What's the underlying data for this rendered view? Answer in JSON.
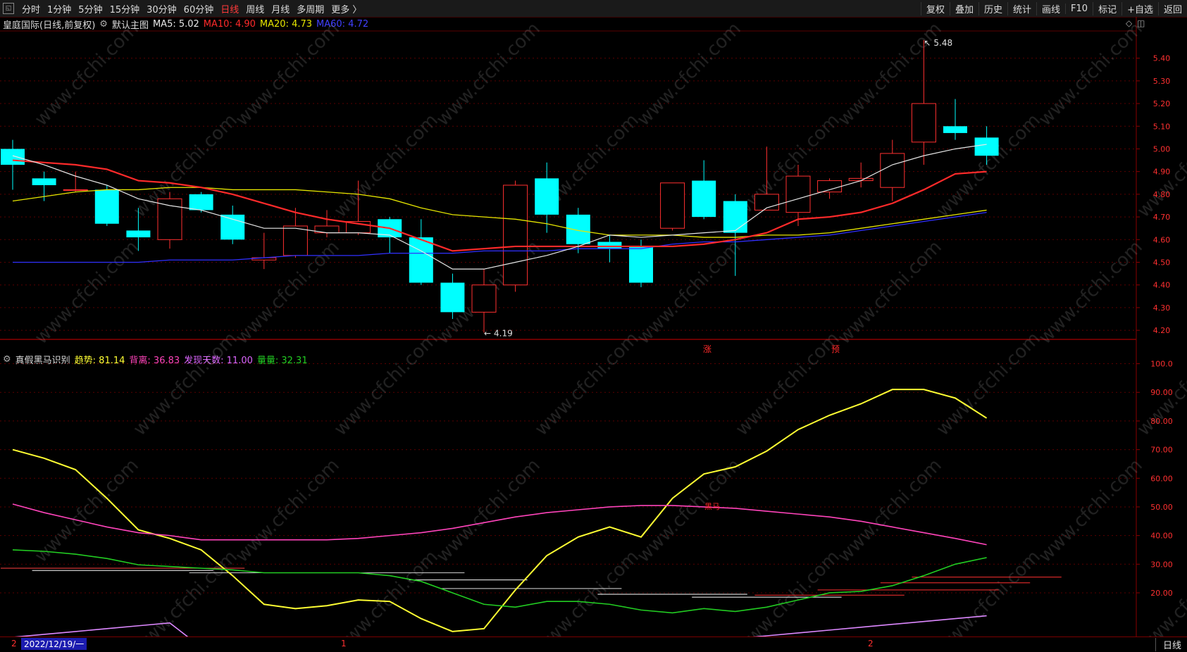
{
  "toolbar": {
    "periods": [
      "分时",
      "1分钟",
      "5分钟",
      "15分钟",
      "30分钟",
      "60分钟",
      "日线",
      "周线",
      "月线",
      "多周期",
      "更多 〉"
    ],
    "active": "日线",
    "right": [
      "复权",
      "叠加",
      "历史",
      "统计",
      "画线",
      "F10",
      "标记",
      "+自选",
      "返回"
    ]
  },
  "main_info": {
    "stock": "皇庭国际(日线,前复权)",
    "template": "默认主图",
    "ma5": "MA5: 5.02",
    "ma10": "MA10: 4.90",
    "ma20": "MA20: 4.73",
    "ma60": "MA60: 4.72",
    "colors": {
      "ma5": "#e8e8e8",
      "ma10": "#ff2a2a",
      "ma20": "#e6e600",
      "ma60": "#3030ff"
    }
  },
  "indicator_info": {
    "name": "真假黑马识别",
    "trend": "趋势: 81.14",
    "diverge": "背离: 36.83",
    "days": "发现天数: 11.00",
    "volume": "量量: 32.31"
  },
  "annotations": {
    "high": "5.48",
    "low": "4.19",
    "zhang": "涨",
    "yu": "预",
    "heima": "黑马"
  },
  "bottom": {
    "date": "2022/12/19/一",
    "marks": [
      "2",
      "1",
      "2"
    ],
    "period_tab": "日线"
  },
  "chart_data": [
    {
      "type": "candlestick",
      "ylim": [
        4.16,
        5.52
      ],
      "yticks": [
        "5.40",
        "5.30",
        "5.20",
        "5.10",
        "5.00",
        "4.90",
        "4.80",
        "4.70",
        "4.60",
        "4.50",
        "4.40",
        "4.30",
        "4.20"
      ],
      "candles": [
        {
          "o": 5.0,
          "h": 5.04,
          "l": 4.82,
          "c": 4.93
        },
        {
          "o": 4.87,
          "h": 4.9,
          "l": 4.77,
          "c": 4.84
        },
        {
          "o": 4.82,
          "h": 4.9,
          "l": 4.81,
          "c": 4.82
        },
        {
          "o": 4.82,
          "h": 4.84,
          "l": 4.66,
          "c": 4.67
        },
        {
          "o": 4.64,
          "h": 4.74,
          "l": 4.55,
          "c": 4.61
        },
        {
          "o": 4.6,
          "h": 4.81,
          "l": 4.56,
          "c": 4.78
        },
        {
          "o": 4.8,
          "h": 4.81,
          "l": 4.72,
          "c": 4.73
        },
        {
          "o": 4.71,
          "h": 4.75,
          "l": 4.58,
          "c": 4.6
        },
        {
          "o": 4.51,
          "h": 4.63,
          "l": 4.47,
          "c": 4.52
        },
        {
          "o": 4.53,
          "h": 4.74,
          "l": 4.52,
          "c": 4.66
        },
        {
          "o": 4.63,
          "h": 4.73,
          "l": 4.61,
          "c": 4.66
        },
        {
          "o": 4.63,
          "h": 4.86,
          "l": 4.62,
          "c": 4.68
        },
        {
          "o": 4.69,
          "h": 4.7,
          "l": 4.54,
          "c": 4.61
        },
        {
          "o": 4.61,
          "h": 4.69,
          "l": 4.4,
          "c": 4.41
        },
        {
          "o": 4.41,
          "h": 4.45,
          "l": 4.25,
          "c": 4.28
        },
        {
          "o": 4.28,
          "h": 4.47,
          "l": 4.19,
          "c": 4.4
        },
        {
          "o": 4.4,
          "h": 4.86,
          "l": 4.37,
          "c": 4.84
        },
        {
          "o": 4.87,
          "h": 4.94,
          "l": 4.63,
          "c": 4.71
        },
        {
          "o": 4.71,
          "h": 4.74,
          "l": 4.54,
          "c": 4.58
        },
        {
          "o": 4.59,
          "h": 4.62,
          "l": 4.5,
          "c": 4.56
        },
        {
          "o": 4.57,
          "h": 4.6,
          "l": 4.39,
          "c": 4.41
        },
        {
          "o": 4.65,
          "h": 4.85,
          "l": 4.64,
          "c": 4.85
        },
        {
          "o": 4.86,
          "h": 4.95,
          "l": 4.69,
          "c": 4.7
        },
        {
          "o": 4.77,
          "h": 4.8,
          "l": 4.44,
          "c": 4.63
        },
        {
          "o": 4.73,
          "h": 5.01,
          "l": 4.73,
          "c": 4.8
        },
        {
          "o": 4.72,
          "h": 4.93,
          "l": 4.66,
          "c": 4.88
        },
        {
          "o": 4.81,
          "h": 4.87,
          "l": 4.78,
          "c": 4.86
        },
        {
          "o": 4.86,
          "h": 4.94,
          "l": 4.83,
          "c": 4.87
        },
        {
          "o": 4.83,
          "h": 5.04,
          "l": 4.77,
          "c": 4.98
        },
        {
          "o": 5.03,
          "h": 5.48,
          "l": 4.93,
          "c": 5.2
        },
        {
          "o": 5.1,
          "h": 5.22,
          "l": 5.04,
          "c": 5.07
        },
        {
          "o": 5.05,
          "h": 5.1,
          "l": 4.93,
          "c": 4.97
        }
      ],
      "ma5": [
        4.97,
        4.93,
        4.88,
        4.84,
        4.78,
        4.75,
        4.73,
        4.69,
        4.65,
        4.65,
        4.63,
        4.63,
        4.62,
        4.55,
        4.47,
        4.47,
        4.5,
        4.53,
        4.57,
        4.62,
        4.61,
        4.62,
        4.63,
        4.64,
        4.74,
        4.78,
        4.82,
        4.86,
        4.93,
        4.97,
        5.0,
        5.02
      ],
      "ma10": [
        4.95,
        4.94,
        4.93,
        4.91,
        4.86,
        4.85,
        4.83,
        4.8,
        4.76,
        4.72,
        4.69,
        4.67,
        4.65,
        4.6,
        4.55,
        4.56,
        4.57,
        4.57,
        4.57,
        4.57,
        4.57,
        4.57,
        4.58,
        4.6,
        4.63,
        4.69,
        4.7,
        4.72,
        4.76,
        4.82,
        4.89,
        4.9
      ],
      "ma20": [
        4.77,
        4.79,
        4.81,
        4.82,
        4.82,
        4.83,
        4.83,
        4.82,
        4.82,
        4.82,
        4.81,
        4.8,
        4.78,
        4.74,
        4.71,
        4.7,
        4.69,
        4.67,
        4.64,
        4.62,
        4.62,
        4.62,
        4.61,
        4.61,
        4.62,
        4.62,
        4.63,
        4.65,
        4.67,
        4.69,
        4.71,
        4.73
      ],
      "ma60": [
        4.5,
        4.5,
        4.5,
        4.5,
        4.5,
        4.51,
        4.51,
        4.51,
        4.52,
        4.53,
        4.53,
        4.53,
        4.54,
        4.54,
        4.54,
        4.55,
        4.55,
        4.55,
        4.56,
        4.56,
        4.56,
        4.58,
        4.59,
        4.59,
        4.6,
        4.61,
        4.62,
        4.64,
        4.66,
        4.68,
        4.7,
        4.72
      ]
    },
    {
      "type": "line",
      "ylim": [
        5,
        108
      ],
      "yticks": [
        "100.0",
        "90.00",
        "80.00",
        "70.00",
        "60.00",
        "50.00",
        "40.00",
        "30.00",
        "20.00"
      ],
      "series": [
        {
          "color": "#ffff33",
          "values": [
            70,
            67,
            63,
            53,
            42,
            39,
            35,
            26,
            16,
            14.5,
            15.5,
            17.5,
            17,
            11,
            6.5,
            7.5,
            21,
            33,
            39.5,
            43,
            39.5,
            53,
            61.5,
            64,
            69.5,
            77,
            82,
            86,
            91,
            91,
            88,
            81
          ]
        },
        {
          "color": "#ff44bb",
          "values": [
            51,
            48,
            45.5,
            43,
            41,
            40,
            38.5,
            38.5,
            38.5,
            38.5,
            38.5,
            39,
            40,
            41,
            42.5,
            44.5,
            46.5,
            48,
            49,
            50,
            50.5,
            50.5,
            50,
            49.5,
            48.5,
            47.5,
            46.5,
            45,
            43,
            41,
            39,
            36.8
          ]
        },
        {
          "color": "#22cc22",
          "values": [
            35,
            34.5,
            33.5,
            32,
            29.8,
            29.2,
            28.6,
            28,
            27,
            27,
            27,
            27,
            26,
            24,
            20,
            16,
            15,
            17,
            17,
            16,
            14,
            13,
            14.5,
            13.5,
            15,
            17.5,
            20,
            20.5,
            22.5,
            26,
            30,
            32.3
          ]
        },
        {
          "color": "#dd88ff",
          "values": [
            4.5,
            5.5,
            6.5,
            7.5,
            8.5,
            9.5,
            1,
            1,
            1,
            1,
            1,
            1,
            1,
            1,
            1,
            1,
            1,
            1,
            1,
            1,
            1,
            2,
            3,
            4,
            5,
            6,
            7,
            8,
            9,
            10,
            11,
            12
          ]
        }
      ]
    }
  ]
}
